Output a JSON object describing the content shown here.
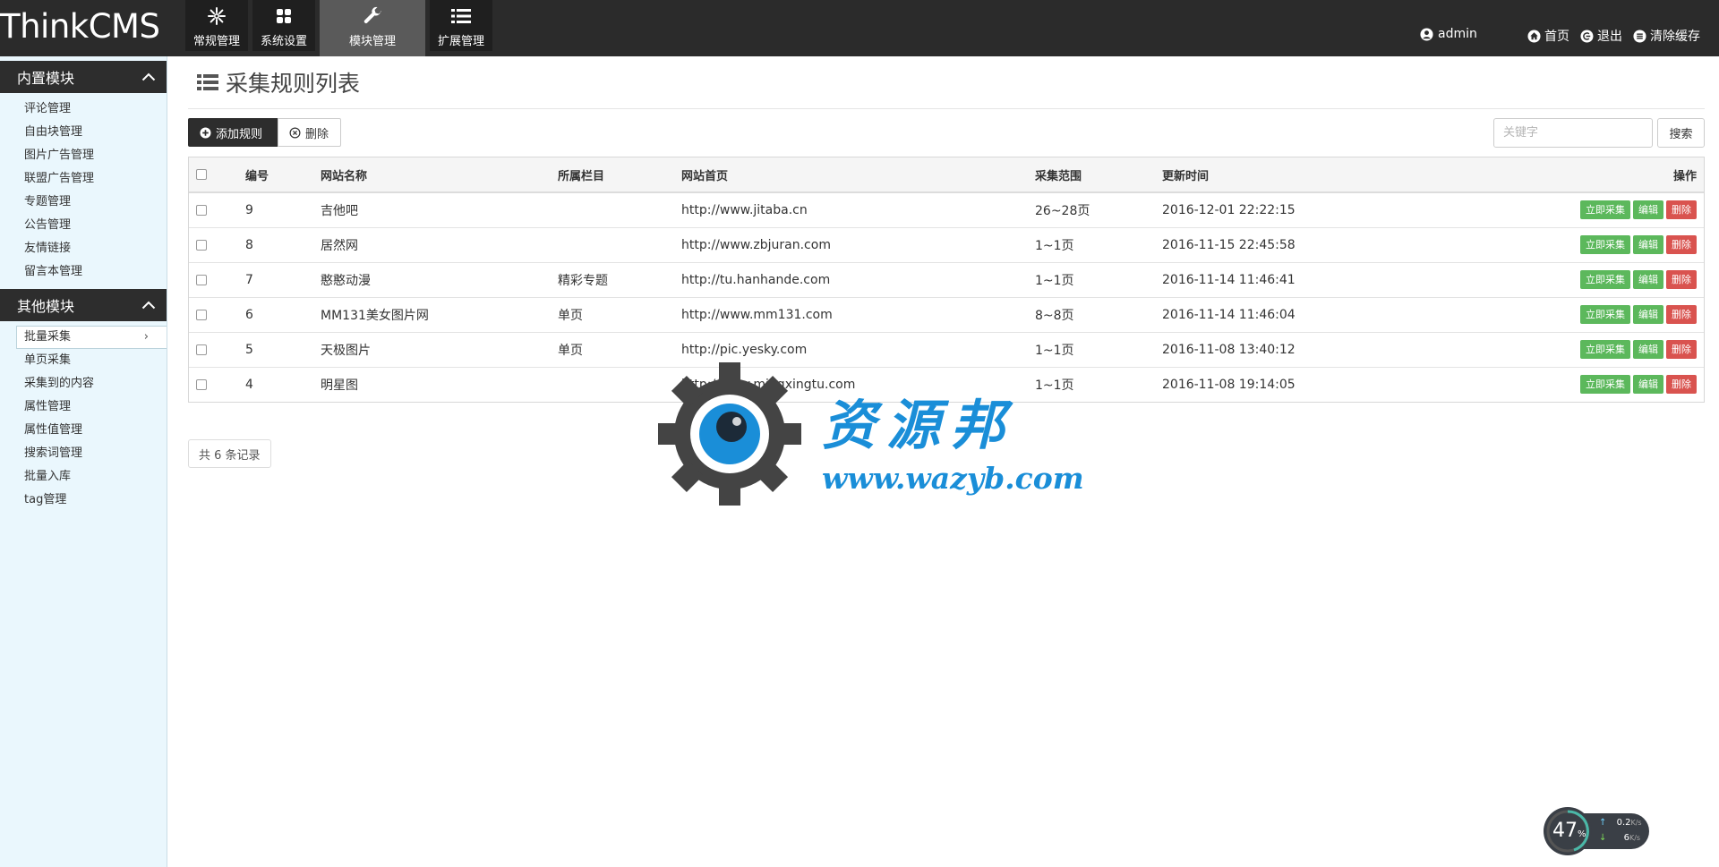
{
  "app": {
    "logo": "ThinkCMS"
  },
  "nav": [
    {
      "label": "常规管理",
      "icon": "snowflake-icon"
    },
    {
      "label": "系统设置",
      "icon": "grid-icon"
    },
    {
      "label": "模块管理",
      "icon": "wrench-icon",
      "active": true
    },
    {
      "label": "扩展管理",
      "icon": "list-icon"
    }
  ],
  "header": {
    "user": "admin",
    "home": "首页",
    "logout": "退出",
    "clear_cache": "清除缓存"
  },
  "sidebar": {
    "groups": [
      {
        "title": "内置模块",
        "items": [
          "评论管理",
          "自由块管理",
          "图片广告管理",
          "联盟广告管理",
          "专题管理",
          "公告管理",
          "友情链接",
          "留言本管理"
        ]
      },
      {
        "title": "其他模块",
        "items": [
          "批量采集",
          "单页采集",
          "采集到的内容",
          "属性管理",
          "属性值管理",
          "搜索词管理",
          "批量入库",
          "tag管理"
        ],
        "active_index": 0
      }
    ],
    "active_arrow": "›"
  },
  "main": {
    "title": "采集规则列表",
    "add_button": "添加规则",
    "delete_button": "删除",
    "search_placeholder": "关键字",
    "search_button": "搜索",
    "total": "共 6 条记录"
  },
  "table": {
    "columns": [
      "编号",
      "网站名称",
      "所属栏目",
      "网站首页",
      "采集范围",
      "更新时间",
      "操作"
    ],
    "rows": [
      {
        "id": "9",
        "name": "吉他吧",
        "column": "",
        "url": "http://www.jitaba.cn",
        "range": "26~28页",
        "updated": "2016-12-01 22:22:15"
      },
      {
        "id": "8",
        "name": "居然网",
        "column": "",
        "url": "http://www.zbjuran.com",
        "range": "1~1页",
        "updated": "2016-11-15 22:45:58"
      },
      {
        "id": "7",
        "name": "憨憨动漫",
        "column": "精彩专题",
        "url": "http://tu.hanhande.com",
        "range": "1~1页",
        "updated": "2016-11-14 11:46:41"
      },
      {
        "id": "6",
        "name": "MM131美女图片网",
        "column": "单页",
        "url": "http://www.mm131.com",
        "range": "8~8页",
        "updated": "2016-11-14 11:46:04"
      },
      {
        "id": "5",
        "name": "天极图片",
        "column": "单页",
        "url": "http://pic.yesky.com",
        "range": "1~1页",
        "updated": "2016-11-08 13:40:12"
      },
      {
        "id": "4",
        "name": "明星图",
        "column": "",
        "url": "http://www.mingxingtu.com",
        "range": "1~1页",
        "updated": "2016-11-08 19:14:05"
      }
    ],
    "actions": {
      "collect": "立即采集",
      "edit": "编辑",
      "delete": "删除"
    }
  },
  "watermark": {
    "title": "资源邦",
    "url": "www.wazyb.com"
  },
  "network": {
    "percent": "47",
    "percent_unit": "%",
    "up": "0.2",
    "down": "6",
    "unit": "K/s"
  },
  "colors": {
    "topbar": "#2b2b2b",
    "sidebar_bg": "#eaf7fd",
    "green": "#5cb85c",
    "red": "#d9534f",
    "watermark_blue": "#1a8ed8"
  }
}
